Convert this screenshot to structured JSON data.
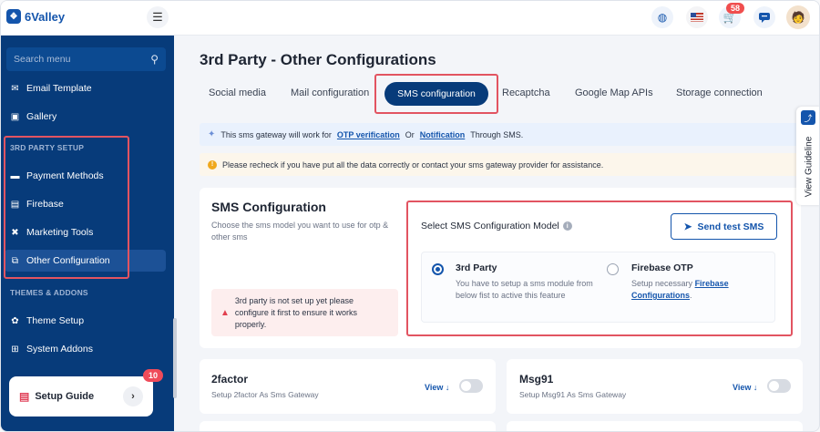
{
  "brand": {
    "name": "6Valley"
  },
  "header": {
    "cart_count": "58",
    "icons": [
      "globe-icon",
      "flag-icon",
      "cart-icon",
      "chat-icon",
      "avatar"
    ]
  },
  "sidebar": {
    "search_placeholder": "Search menu",
    "items": [
      {
        "label": "Email Template",
        "icon": "mail-icon"
      },
      {
        "label": "Gallery",
        "icon": "gallery-icon"
      },
      {
        "label": "Payment Methods",
        "icon": "card-icon"
      },
      {
        "label": "Firebase",
        "icon": "firebase-icon"
      },
      {
        "label": "Marketing Tools",
        "icon": "tools-icon"
      },
      {
        "label": "Other Configuration",
        "icon": "sitemap-icon",
        "active": true
      },
      {
        "label": "Theme Setup",
        "icon": "palette-icon"
      },
      {
        "label": "System Addons",
        "icon": "addons-icon"
      }
    ],
    "sections": {
      "third_party": "3RD PARTY SETUP",
      "themes": "THEMES & ADDONS"
    },
    "setup_guide": {
      "label": "Setup Guide",
      "badge": "10"
    }
  },
  "page": {
    "title": "3rd Party - Other Configurations",
    "tabs": [
      "Social media",
      "Mail configuration",
      "SMS configuration",
      "Recaptcha",
      "Google Map APIs",
      "Storage connection"
    ],
    "active_tab": "SMS configuration"
  },
  "notices": {
    "info_prefix": "This sms gateway will work for",
    "info_link1": "OTP verification",
    "info_or": "Or",
    "info_link2": "Notification",
    "info_suffix": "Through SMS.",
    "warning": "Please recheck if you have put all the data correctly or contact your sms gateway provider for assistance."
  },
  "sms_config": {
    "title": "SMS Configuration",
    "description": "Choose the sms model you want to use for otp & other sms",
    "alert": "3rd party is not set up yet please configure it first to ensure it works properly.",
    "model_label": "Select SMS Configuration Model",
    "send_button": "Send test SMS",
    "options": [
      {
        "title": "3rd Party",
        "desc": "You have to setup a sms module from below fist to active this feature",
        "selected": true
      },
      {
        "title": "Firebase OTP",
        "desc_prefix": "Setup necessary",
        "link": "Firebase Configurations",
        "desc_suffix": ".",
        "selected": false
      }
    ]
  },
  "gateways": [
    {
      "name": "2factor",
      "desc": "Setup 2factor As Sms Gateway",
      "view": "View",
      "enabled": false
    },
    {
      "name": "Msg91",
      "desc": "Setup Msg91 As Sms Gateway",
      "view": "View",
      "enabled": false
    }
  ],
  "view_guideline": "View Guideline"
}
